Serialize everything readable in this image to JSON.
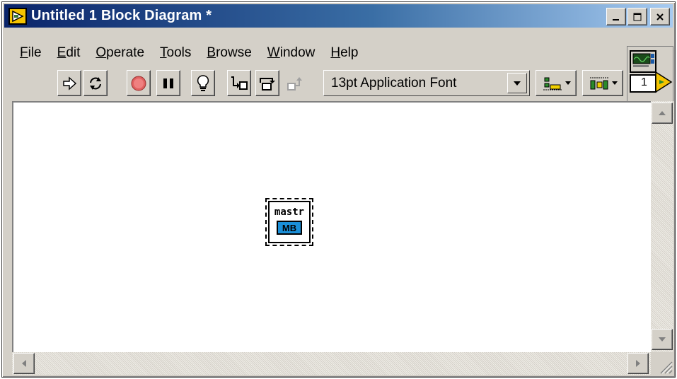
{
  "window": {
    "title": "Untitled 1 Block Diagram *"
  },
  "menu": {
    "items": [
      {
        "label": "File",
        "key": "F",
        "rest": "ile"
      },
      {
        "label": "Edit",
        "key": "E",
        "rest": "dit"
      },
      {
        "label": "Operate",
        "key": "O",
        "rest": "perate"
      },
      {
        "label": "Tools",
        "key": "T",
        "rest": "ools"
      },
      {
        "label": "Browse",
        "key": "B",
        "rest": "rowse"
      },
      {
        "label": "Window",
        "key": "W",
        "rest": "indow"
      },
      {
        "label": "Help",
        "key": "H",
        "rest": "elp"
      }
    ]
  },
  "toolbar": {
    "font_selector": "13pt Application Font",
    "icons": [
      "run-icon",
      "run-continuously-icon",
      "abort-icon",
      "pause-icon",
      "highlight-execution-icon",
      "step-into-icon",
      "step-over-icon",
      "step-out-icon",
      "align-objects-icon",
      "distribute-objects-icon"
    ]
  },
  "connector_pane": {
    "number": "1"
  },
  "diagram": {
    "node_label": "mastr",
    "node_badge": "MB"
  },
  "colors": {
    "title_start": "#0a246a",
    "title_end": "#a6caf0",
    "chrome": "#d4d0c8",
    "badge": "#1a8fd8",
    "abort": "#e06060"
  }
}
